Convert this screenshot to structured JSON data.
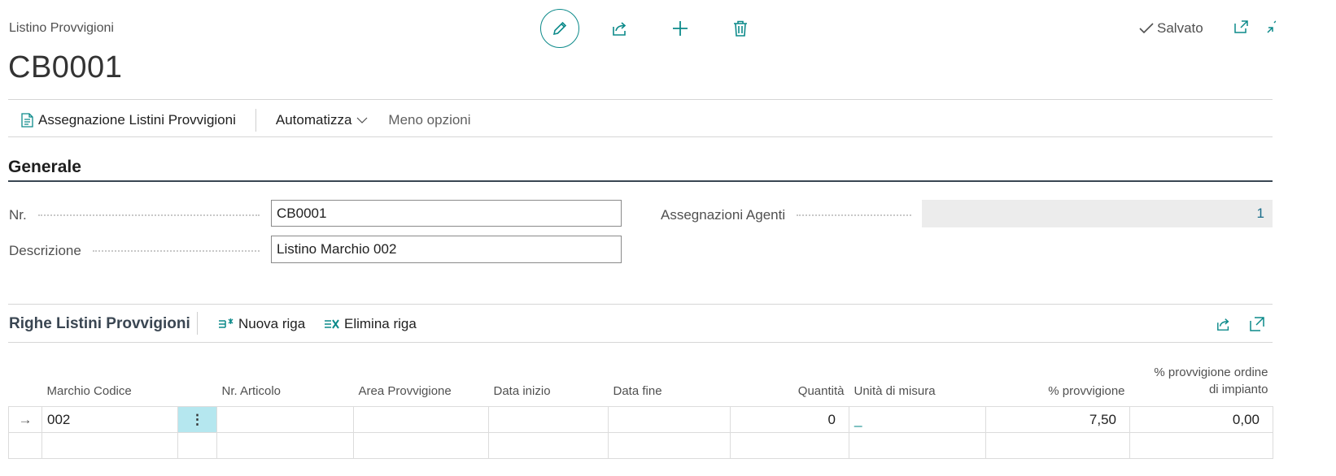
{
  "page": {
    "caption": "Listino Provvigioni",
    "title": "CB0001",
    "saved_label": "Salvato"
  },
  "toolbar": {
    "assign_label": "Assegnazione Listini Provvigioni",
    "automate_label": "Automatizza",
    "less_options_label": "Meno opzioni"
  },
  "general": {
    "title": "Generale",
    "nr_label": "Nr.",
    "nr_value": "CB0001",
    "description_label": "Descrizione",
    "description_value": "Listino Marchio 002",
    "agents_label": "Assegnazioni Agenti",
    "agents_value": "1"
  },
  "lines": {
    "title": "Righe Listini Provvigioni",
    "new_line_label": "Nuova riga",
    "delete_line_label": "Elimina riga",
    "columns": {
      "brand": "Marchio Codice",
      "item": "Nr. Articolo",
      "area": "Area Provvigione",
      "start": "Data inizio",
      "end": "Data fine",
      "qty": "Quantità",
      "uom": "Unità di misura",
      "pct": "% provvigione",
      "pct_setup_1": "% provvigione ordine",
      "pct_setup_2": "di impianto"
    },
    "rows": [
      {
        "marker": "→",
        "brand": "002",
        "menu": "⋮",
        "item": "",
        "area": "",
        "start": "",
        "end": "",
        "qty": "0",
        "uom": "_",
        "pct": "7,50",
        "pct_setup": "0,00"
      }
    ]
  },
  "colors": {
    "accent": "#0c8a8a",
    "selected_cell": "#b5e7ef"
  },
  "icons": [
    "edit-icon",
    "share-icon",
    "add-icon",
    "delete-icon",
    "checkmark-icon",
    "open-new-window-icon",
    "collapse-icon",
    "report-icon",
    "chevron-down-icon",
    "new-line-icon",
    "delete-line-icon",
    "expand-icon"
  ]
}
